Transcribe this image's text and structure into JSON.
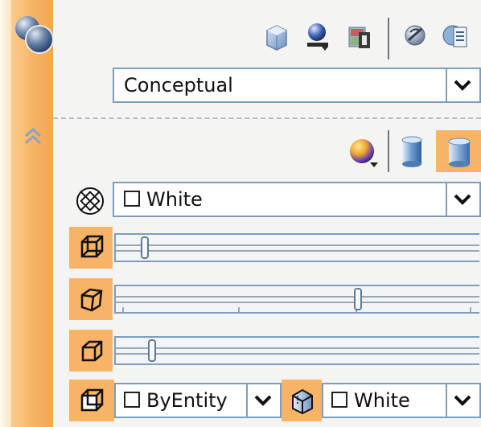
{
  "visual_style": {
    "selected": "Conceptual"
  },
  "face_settings": {
    "color_value": "White"
  },
  "edge_settings": {
    "color_value": "ByEntity",
    "obscured_color_value": "White"
  },
  "sliders": {
    "opacity": 0.07,
    "crease_angle": 0.67,
    "edge_jitter": 0.09
  },
  "colors": {
    "accent_orange": "#f7b366",
    "border_blue": "#7d9dbd",
    "panel_bg": "#f4f4f2"
  }
}
